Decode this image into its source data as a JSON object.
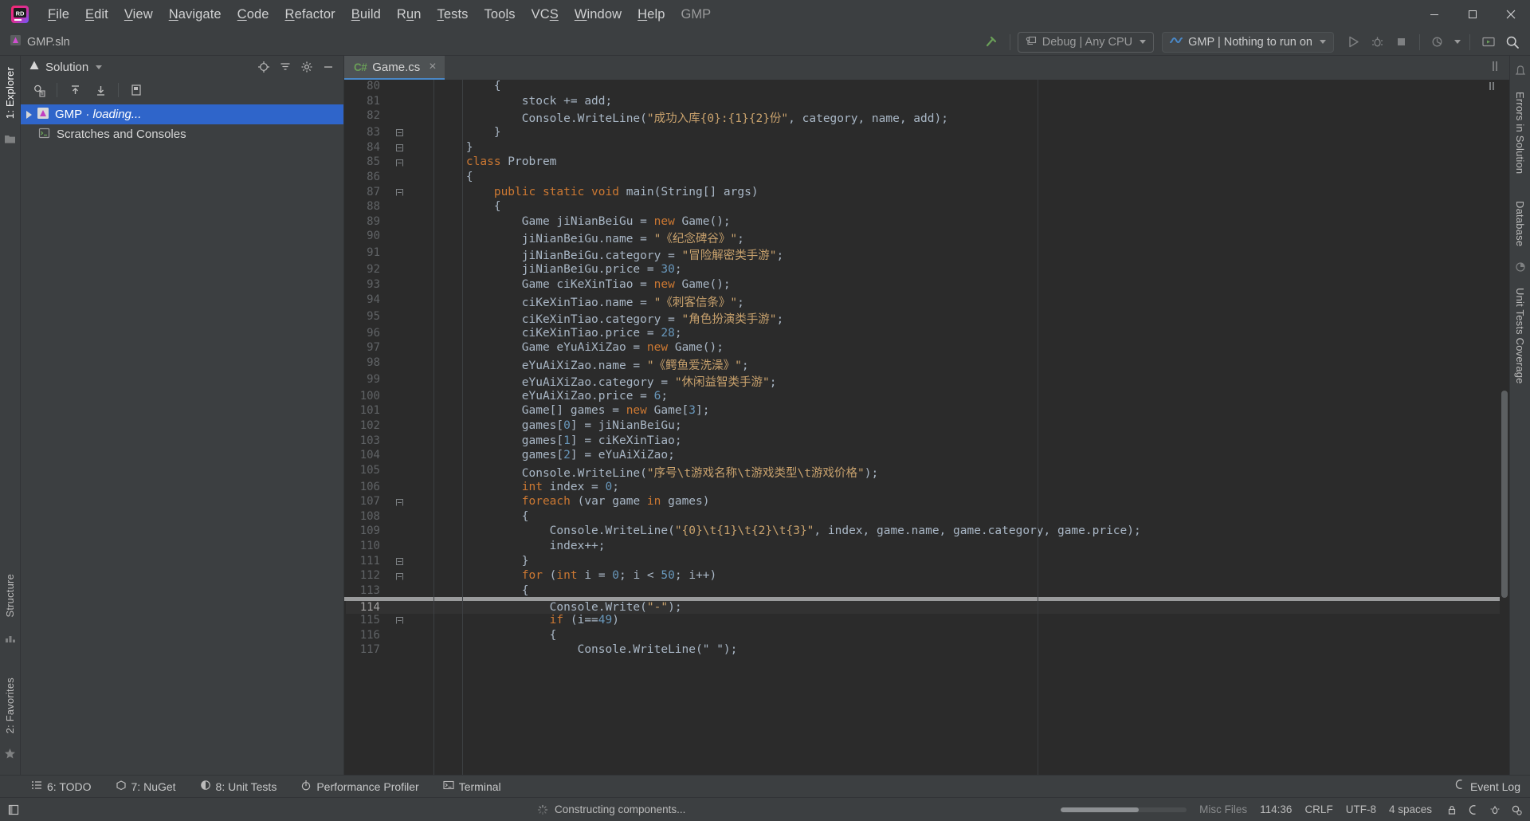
{
  "window": {
    "app_title": "GMP",
    "project_file": "GMP.sln"
  },
  "menubar": {
    "items": [
      {
        "label": "File",
        "mnemonic": "F"
      },
      {
        "label": "Edit",
        "mnemonic": "E"
      },
      {
        "label": "View",
        "mnemonic": "V"
      },
      {
        "label": "Navigate",
        "mnemonic": "N"
      },
      {
        "label": "Code",
        "mnemonic": "C"
      },
      {
        "label": "Refactor",
        "mnemonic": "R"
      },
      {
        "label": "Build",
        "mnemonic": "B"
      },
      {
        "label": "Run",
        "mnemonic": "u"
      },
      {
        "label": "Tests",
        "mnemonic": "T"
      },
      {
        "label": "Tools",
        "mnemonic": "l"
      },
      {
        "label": "VCS",
        "mnemonic": "S"
      },
      {
        "label": "Window",
        "mnemonic": "W"
      },
      {
        "label": "Help",
        "mnemonic": "H"
      }
    ],
    "window_controls": {
      "minimize": "minimize-button",
      "maximize": "maximize-button",
      "close": "close-button"
    }
  },
  "toolbar": {
    "breadcrumb": "GMP.sln",
    "build_icon": "hammer-icon",
    "configuration": "Debug | Any CPU",
    "run_configuration": "GMP | Nothing to run on",
    "run_button": "run-button",
    "debug_button": "debug-button",
    "stop_button": "stop-button",
    "profile_button": "profile-with-dropdown-button",
    "updates_button": "updates-icon",
    "search_button": "search-everywhere-icon"
  },
  "left_rail": {
    "items": [
      {
        "label": "1: Explorer",
        "active": true
      },
      {
        "label": "Structure",
        "active": false
      },
      {
        "label": "2: Favorites",
        "active": false
      }
    ],
    "bottom_icon": "star-icon",
    "folder_icon": "folder-icon",
    "structure_icon": "structure-icon"
  },
  "right_rail": {
    "items": [
      {
        "label": "Errors in Solution"
      },
      {
        "label": "Database"
      },
      {
        "label": "Unit Tests Coverage"
      }
    ],
    "top_icon": "notifications-icon",
    "mid_icon": "coverage-icon"
  },
  "solution_panel": {
    "title": "Solution",
    "title_icon": "solution-icon",
    "header_icons": [
      "locate-icon",
      "collapse-all-icon",
      "settings-gear-icon",
      "hide-icon"
    ],
    "toolbar_icons": [
      "search-in-solution-icon",
      "expand-up-icon",
      "collapse-down-icon",
      "properties-icon"
    ],
    "tree": [
      {
        "label": "GMP",
        "suffix": " · loading...",
        "selected": true,
        "icon": "solution-node-icon",
        "expandable": true
      },
      {
        "label": "Scratches and Consoles",
        "suffix": "",
        "selected": false,
        "icon": "scratches-icon",
        "expandable": false
      }
    ]
  },
  "editor": {
    "tab": {
      "label": "Game.cs",
      "badge": "C#",
      "close": "×"
    },
    "first_line_number": 80,
    "caret_line": 114,
    "lines": [
      {
        "n": 80,
        "fold": "",
        "tokens": [
          {
            "t": "        {",
            "c": "pln"
          }
        ]
      },
      {
        "n": 81,
        "fold": "",
        "tokens": [
          {
            "t": "            stock += add;",
            "c": "pln"
          }
        ]
      },
      {
        "n": 82,
        "fold": "",
        "tokens": [
          {
            "t": "            Console.WriteLine(",
            "c": "pln"
          },
          {
            "t": "\"成功入库{0}:{1}{2}份\"",
            "c": "str"
          },
          {
            "t": ", category, name, add);",
            "c": "pln"
          }
        ]
      },
      {
        "n": 83,
        "fold": "close",
        "tokens": [
          {
            "t": "        }",
            "c": "pln"
          }
        ]
      },
      {
        "n": 84,
        "fold": "close",
        "tokens": [
          {
            "t": "    }",
            "c": "pln"
          }
        ]
      },
      {
        "n": 85,
        "fold": "open",
        "tokens": [
          {
            "t": "    class",
            "c": "kw"
          },
          {
            "t": " Probrem",
            "c": "pln"
          }
        ]
      },
      {
        "n": 86,
        "fold": "",
        "tokens": [
          {
            "t": "    {",
            "c": "pln"
          }
        ]
      },
      {
        "n": 87,
        "fold": "open",
        "tokens": [
          {
            "t": "        public static void",
            "c": "kw"
          },
          {
            "t": " main(String[] args)",
            "c": "pln"
          }
        ]
      },
      {
        "n": 88,
        "fold": "",
        "tokens": [
          {
            "t": "        {",
            "c": "pln"
          }
        ]
      },
      {
        "n": 89,
        "fold": "",
        "tokens": [
          {
            "t": "            Game jiNianBeiGu = ",
            "c": "pln"
          },
          {
            "t": "new",
            "c": "kw"
          },
          {
            "t": " Game();",
            "c": "pln"
          }
        ]
      },
      {
        "n": 90,
        "fold": "",
        "tokens": [
          {
            "t": "            jiNianBeiGu.name = ",
            "c": "pln"
          },
          {
            "t": "\"《纪念碑谷》\"",
            "c": "str"
          },
          {
            "t": ";",
            "c": "pln"
          }
        ]
      },
      {
        "n": 91,
        "fold": "",
        "tokens": [
          {
            "t": "            jiNianBeiGu.category = ",
            "c": "pln"
          },
          {
            "t": "\"冒险解密类手游\"",
            "c": "str"
          },
          {
            "t": ";",
            "c": "pln"
          }
        ]
      },
      {
        "n": 92,
        "fold": "",
        "tokens": [
          {
            "t": "            jiNianBeiGu.price = ",
            "c": "pln"
          },
          {
            "t": "30",
            "c": "num"
          },
          {
            "t": ";",
            "c": "pln"
          }
        ]
      },
      {
        "n": 93,
        "fold": "",
        "tokens": [
          {
            "t": "            Game ciKeXinTiao = ",
            "c": "pln"
          },
          {
            "t": "new",
            "c": "kw"
          },
          {
            "t": " Game();",
            "c": "pln"
          }
        ]
      },
      {
        "n": 94,
        "fold": "",
        "tokens": [
          {
            "t": "            ciKeXinTiao.name = ",
            "c": "pln"
          },
          {
            "t": "\"《刺客信条》\"",
            "c": "str"
          },
          {
            "t": ";",
            "c": "pln"
          }
        ]
      },
      {
        "n": 95,
        "fold": "",
        "tokens": [
          {
            "t": "            ciKeXinTiao.category = ",
            "c": "pln"
          },
          {
            "t": "\"角色扮演类手游\"",
            "c": "str"
          },
          {
            "t": ";",
            "c": "pln"
          }
        ]
      },
      {
        "n": 96,
        "fold": "",
        "tokens": [
          {
            "t": "            ciKeXinTiao.price = ",
            "c": "pln"
          },
          {
            "t": "28",
            "c": "num"
          },
          {
            "t": ";",
            "c": "pln"
          }
        ]
      },
      {
        "n": 97,
        "fold": "",
        "tokens": [
          {
            "t": "            Game eYuAiXiZao = ",
            "c": "pln"
          },
          {
            "t": "new",
            "c": "kw"
          },
          {
            "t": " Game();",
            "c": "pln"
          }
        ]
      },
      {
        "n": 98,
        "fold": "",
        "tokens": [
          {
            "t": "            eYuAiXiZao.name = ",
            "c": "pln"
          },
          {
            "t": "\"《鳄鱼爱洗澡》\"",
            "c": "str"
          },
          {
            "t": ";",
            "c": "pln"
          }
        ]
      },
      {
        "n": 99,
        "fold": "",
        "tokens": [
          {
            "t": "            eYuAiXiZao.category = ",
            "c": "pln"
          },
          {
            "t": "\"休闲益智类手游\"",
            "c": "str"
          },
          {
            "t": ";",
            "c": "pln"
          }
        ]
      },
      {
        "n": 100,
        "fold": "",
        "tokens": [
          {
            "t": "            eYuAiXiZao.price = ",
            "c": "pln"
          },
          {
            "t": "6",
            "c": "num"
          },
          {
            "t": ";",
            "c": "pln"
          }
        ]
      },
      {
        "n": 101,
        "fold": "",
        "tokens": [
          {
            "t": "            Game[] games = ",
            "c": "pln"
          },
          {
            "t": "new",
            "c": "kw"
          },
          {
            "t": " Game[",
            "c": "pln"
          },
          {
            "t": "3",
            "c": "num"
          },
          {
            "t": "];",
            "c": "pln"
          }
        ]
      },
      {
        "n": 102,
        "fold": "",
        "tokens": [
          {
            "t": "            games[",
            "c": "pln"
          },
          {
            "t": "0",
            "c": "num"
          },
          {
            "t": "] = jiNianBeiGu;",
            "c": "pln"
          }
        ]
      },
      {
        "n": 103,
        "fold": "",
        "tokens": [
          {
            "t": "            games[",
            "c": "pln"
          },
          {
            "t": "1",
            "c": "num"
          },
          {
            "t": "] = ciKeXinTiao;",
            "c": "pln"
          }
        ]
      },
      {
        "n": 104,
        "fold": "",
        "tokens": [
          {
            "t": "            games[",
            "c": "pln"
          },
          {
            "t": "2",
            "c": "num"
          },
          {
            "t": "] = eYuAiXiZao;",
            "c": "pln"
          }
        ]
      },
      {
        "n": 105,
        "fold": "",
        "tokens": [
          {
            "t": "            Console.WriteLine(",
            "c": "pln"
          },
          {
            "t": "\"序号\\t游戏名称\\t游戏类型\\t游戏价格\"",
            "c": "str"
          },
          {
            "t": ");",
            "c": "pln"
          }
        ]
      },
      {
        "n": 106,
        "fold": "",
        "tokens": [
          {
            "t": "            int",
            "c": "kw"
          },
          {
            "t": " index = ",
            "c": "pln"
          },
          {
            "t": "0",
            "c": "num"
          },
          {
            "t": ";",
            "c": "pln"
          }
        ]
      },
      {
        "n": 107,
        "fold": "open",
        "tokens": [
          {
            "t": "            foreach",
            "c": "kw"
          },
          {
            "t": " (var game ",
            "c": "pln"
          },
          {
            "t": "in",
            "c": "kw"
          },
          {
            "t": " games)",
            "c": "pln"
          }
        ]
      },
      {
        "n": 108,
        "fold": "",
        "tokens": [
          {
            "t": "            {",
            "c": "pln"
          }
        ]
      },
      {
        "n": 109,
        "fold": "",
        "tokens": [
          {
            "t": "                Console.WriteLine(",
            "c": "pln"
          },
          {
            "t": "\"{0}\\t{1}\\t{2}\\t{3}\"",
            "c": "str"
          },
          {
            "t": ", index, game.name, game.category, game.price);",
            "c": "pln"
          }
        ]
      },
      {
        "n": 110,
        "fold": "",
        "tokens": [
          {
            "t": "                index++;",
            "c": "pln"
          }
        ]
      },
      {
        "n": 111,
        "fold": "close",
        "tokens": [
          {
            "t": "            }",
            "c": "pln"
          }
        ]
      },
      {
        "n": 112,
        "fold": "open",
        "tokens": [
          {
            "t": "            for",
            "c": "kw"
          },
          {
            "t": " (",
            "c": "pln"
          },
          {
            "t": "int",
            "c": "kw"
          },
          {
            "t": " i = ",
            "c": "pln"
          },
          {
            "t": "0",
            "c": "num"
          },
          {
            "t": "; i < ",
            "c": "pln"
          },
          {
            "t": "50",
            "c": "num"
          },
          {
            "t": "; i++)",
            "c": "pln"
          }
        ]
      },
      {
        "n": 113,
        "fold": "",
        "tokens": [
          {
            "t": "            {",
            "c": "pln"
          }
        ]
      },
      {
        "n": 114,
        "fold": "",
        "tokens": [
          {
            "t": "                Console.Write(",
            "c": "pln"
          },
          {
            "t": "\"-\"",
            "c": "str"
          },
          {
            "t": ");",
            "c": "pln"
          }
        ]
      },
      {
        "n": 115,
        "fold": "open",
        "tokens": [
          {
            "t": "                if",
            "c": "kw"
          },
          {
            "t": " (i==",
            "c": "pln"
          },
          {
            "t": "49",
            "c": "num"
          },
          {
            "t": ")",
            "c": "pln"
          }
        ]
      },
      {
        "n": 116,
        "fold": "",
        "tokens": [
          {
            "t": "                {",
            "c": "pln"
          }
        ]
      },
      {
        "n": 117,
        "fold": "",
        "tokens": [
          {
            "t": "                    Console.WriteLine(\" \");",
            "c": "pln"
          }
        ]
      }
    ]
  },
  "bottom_bar": {
    "items": [
      {
        "label": "6: TODO",
        "mnemonic": "6",
        "icon": "todo-icon"
      },
      {
        "label": "7: NuGet",
        "mnemonic": "7",
        "icon": "nuget-icon"
      },
      {
        "label": "8: Unit Tests",
        "mnemonic": "8",
        "icon": "unit-tests-icon"
      },
      {
        "label": "Performance Profiler",
        "mnemonic": "",
        "icon": "profiler-icon"
      },
      {
        "label": "Terminal",
        "mnemonic": "",
        "icon": "terminal-icon"
      }
    ],
    "event_log": "Event Log",
    "event_log_icon": "event-log-icon"
  },
  "statusbar": {
    "message": "Constructing components...",
    "progress_percent": 62,
    "file_scope": "Misc Files",
    "caret_position": "114:36",
    "line_separator": "CRLF",
    "encoding": "UTF-8",
    "indent": "4 spaces",
    "icons": [
      "lock-icon",
      "read-only-icon",
      "inspection-icon",
      "settings-icon"
    ]
  },
  "colors": {
    "accent_blue": "#2f65ca",
    "tab_underline": "#4a88c7",
    "editor_bg": "#2b2b2b",
    "chrome_bg": "#3c3f41",
    "string": "#c9a26d",
    "keyword": "#cc7832",
    "number": "#6897bb",
    "text": "#a9b7c6",
    "line_number": "#606366"
  }
}
